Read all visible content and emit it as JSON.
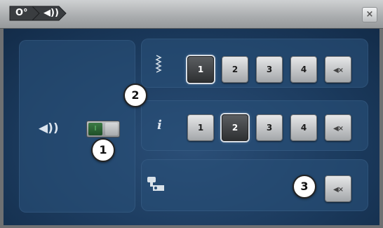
{
  "breadcrumb": {
    "setup_glyph": "O°",
    "audio_glyph": "◀))"
  },
  "close_label": "×",
  "sound_main": {
    "speaker_glyph": "◀))",
    "toggle_on_label": "I"
  },
  "stitch_row": {
    "icon": "stitch-selection-icon",
    "options": [
      "1",
      "2",
      "3",
      "4"
    ],
    "selected": "1",
    "mute_label": "◀×"
  },
  "info_row": {
    "icon_label": "i",
    "options": [
      "1",
      "2",
      "3",
      "4"
    ],
    "selected": "2",
    "mute_label": "◀×"
  },
  "bobbin_row": {
    "icon": "bobbin-winder-icon",
    "mute_label": "◀×"
  },
  "callouts": [
    "1",
    "2",
    "3"
  ],
  "colors": {
    "background": "#1b3a5d",
    "panel": "#284e76",
    "selected_button": "#2e3032"
  }
}
